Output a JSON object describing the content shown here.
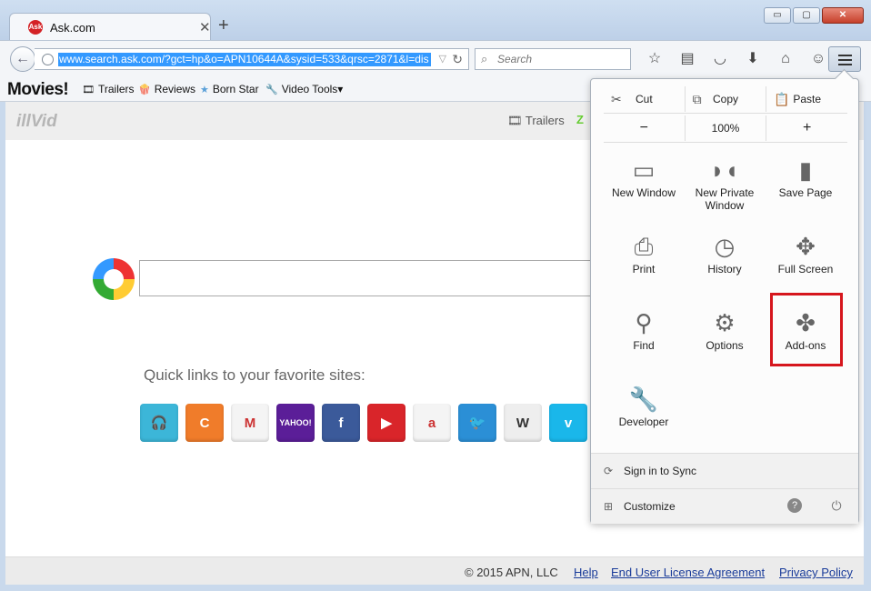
{
  "tab": {
    "title": "Ask.com",
    "favicon": "Ask"
  },
  "window": {
    "minimize": "▭",
    "maximize": "▢",
    "close": "✕"
  },
  "address": {
    "url": "www.search.ask.com/?gct=hp&o=APN10644A&sysid=533&qrsc=2871&l=dis"
  },
  "search": {
    "placeholder": "Search"
  },
  "bookmarks": {
    "logo": "Movies!",
    "items": [
      {
        "label": "Trailers",
        "icon": "film-icon"
      },
      {
        "label": "Reviews",
        "icon": "popcorn-icon"
      },
      {
        "label": "Born Star",
        "icon": "star-icon"
      },
      {
        "label": "Video Tools▾",
        "icon": "wrench-icon"
      }
    ]
  },
  "site": {
    "brand": "illVid",
    "nav_trailers": "Trailers",
    "quick_title": "Quick links to your favorite sites:",
    "quicklinks": [
      {
        "name": "headphones",
        "glyph": "🎧",
        "color": "#3cb6d8"
      },
      {
        "name": "c-app",
        "glyph": "C",
        "color": "#f07c2a"
      },
      {
        "name": "gmail",
        "glyph": "M",
        "color": "#f4f4f4"
      },
      {
        "name": "yahoo",
        "glyph": "YAHOO!",
        "color": "#5b1e98"
      },
      {
        "name": "facebook",
        "glyph": "f",
        "color": "#3b5a9a"
      },
      {
        "name": "youtube",
        "glyph": "▶",
        "color": "#d9252a"
      },
      {
        "name": "amazon",
        "glyph": "a",
        "color": "#f4f4f4"
      },
      {
        "name": "twitter",
        "glyph": "🐦",
        "color": "#2b8fd6"
      },
      {
        "name": "wikipedia",
        "glyph": "W",
        "color": "#eeeeee"
      },
      {
        "name": "vimeo",
        "glyph": "v",
        "color": "#1ab7ea"
      }
    ],
    "footer": {
      "copyright": "© 2015 APN, LLC",
      "help": "Help",
      "eula": "End User License Agreement",
      "privacy": "Privacy Policy"
    }
  },
  "menu": {
    "cut": "Cut",
    "copy": "Copy",
    "paste": "Paste",
    "zoom_out": "−",
    "zoom_level": "100%",
    "zoom_in": "+",
    "items": {
      "new_window": "New Window",
      "new_private_window": "New Private Window",
      "save_page": "Save Page",
      "print": "Print",
      "history": "History",
      "full_screen": "Full Screen",
      "find": "Find",
      "options": "Options",
      "addons": "Add-ons",
      "developer": "Developer"
    },
    "sign_in": "Sign in to Sync",
    "customize": "Customize"
  }
}
